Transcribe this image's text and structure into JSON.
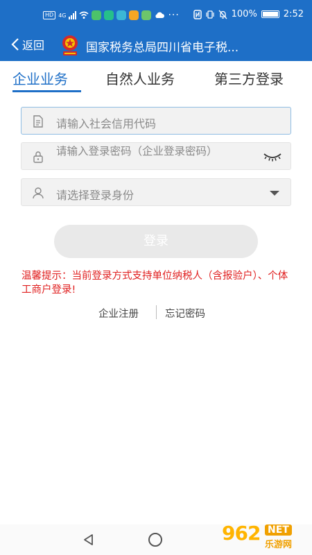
{
  "status_bar": {
    "hd_badge": "HD",
    "network": "4G",
    "battery": "100%",
    "time": "2:52"
  },
  "nav": {
    "back_label": "返回",
    "title": "国家税务总局四川省电子税..."
  },
  "tabs": [
    {
      "label": "企业业务",
      "active": true
    },
    {
      "label": "自然人业务",
      "active": false
    },
    {
      "label": "第三方登录",
      "active": false
    }
  ],
  "form": {
    "credit_code_placeholder": "请输入社会信用代码",
    "password_placeholder": "请输入登录密码（企业登录密码）",
    "identity_placeholder": "请选择登录身份",
    "login_label": "登录"
  },
  "tip": "温馨提示：当前登录方式支持单位纳税人（含报验户）、个体工商户登录!",
  "links": {
    "register": "企业注册",
    "forgot": "忘记密码"
  },
  "watermark": {
    "number": "962",
    "net": "NET",
    "cn": "乐游网"
  },
  "colors": {
    "primary": "#1e6fc7",
    "tip": "#e02020",
    "button_disabled": "#e9e9e9"
  },
  "icons": [
    "back-chevron-icon",
    "tax-emblem-icon",
    "document-icon",
    "lock-icon",
    "eye-closed-icon",
    "user-icon",
    "dropdown-caret-icon",
    "nav-back-icon",
    "nav-home-icon"
  ]
}
